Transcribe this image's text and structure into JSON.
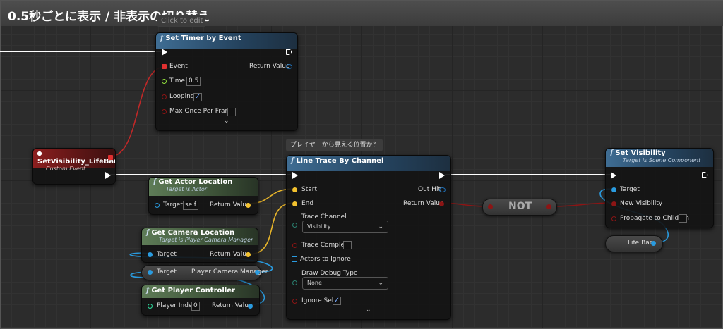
{
  "comment": {
    "title": "0.5秒ごとに表示 / 非表示の切り替え",
    "edit_hint": "Click to edit"
  },
  "set_timer": {
    "title": "Set Timer by Event",
    "event": "Event",
    "return_value": "Return Value",
    "time_label": "Time",
    "time_value": "0.5",
    "looping": "Looping",
    "looping_checked": "✓",
    "max_once": "Max Once Per Frame",
    "expand": "⌄"
  },
  "custom_event": {
    "title": "SetVisibility_LifeBar",
    "subtitle": "Custom Event"
  },
  "get_actor_location": {
    "title": "Get Actor Location",
    "subtitle": "Target is Actor",
    "target": "Target",
    "target_value": "self",
    "return_value": "Return Value"
  },
  "get_camera_location": {
    "title": "Get Camera Location",
    "subtitle": "Target is Player Camera Manager",
    "target": "Target",
    "return_value": "Return Value"
  },
  "camera_manager_var": {
    "target": "Target",
    "label": "Player Camera Manager"
  },
  "get_player_controller": {
    "title": "Get Player Controller",
    "player_index": "Player Index",
    "index_value": "0",
    "return_value": "Return Value"
  },
  "tooltip": "プレイヤーから見える位置か？",
  "line_trace": {
    "title": "Line Trace By Channel",
    "start": "Start",
    "end": "End",
    "out_hit": "Out Hit",
    "return_value": "Return Value",
    "trace_channel": "Trace Channel",
    "trace_channel_value": "Visibility",
    "trace_complex": "Trace Complex",
    "actors_to_ignore": "Actors to Ignore",
    "draw_debug_type": "Draw Debug Type",
    "draw_debug_value": "None",
    "ignore_self": "Ignore Self",
    "ignore_self_checked": "✓",
    "expand": "⌄"
  },
  "not_node": {
    "label": "NOT"
  },
  "set_visibility": {
    "title": "Set Visibility",
    "subtitle": "Target is Scene Component",
    "target": "Target",
    "new_visibility": "New Visibility",
    "propagate": "Propagate to Children"
  },
  "life_bar_var": {
    "label": "Life Bar"
  },
  "colors": {
    "exec": "#ffffff",
    "event_delegate": "#e03030",
    "float": "#8fdc3c",
    "bool": "#8c1515",
    "vector": "#f2c12e",
    "object": "#2a9bdf",
    "struct": "#1f6fb5",
    "int": "#2ee0a0"
  }
}
